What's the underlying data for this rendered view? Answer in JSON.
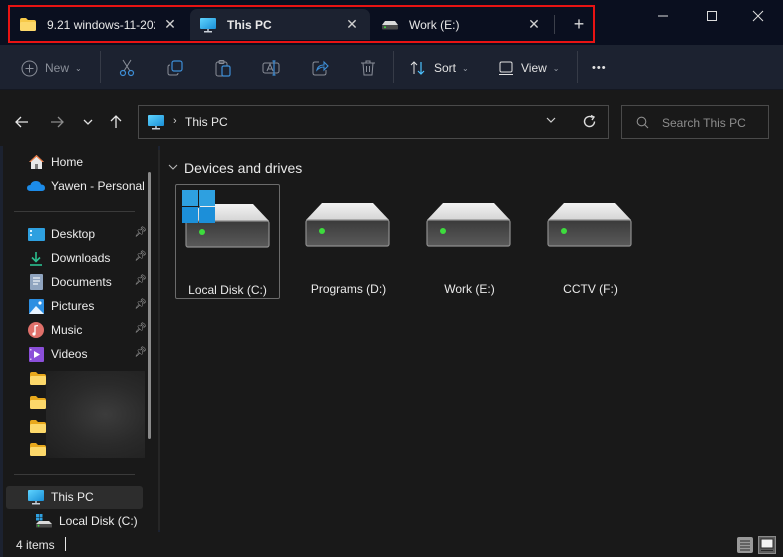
{
  "window": {
    "tabs": [
      {
        "label": "9.21 windows-11-202",
        "icon": "folder-icon",
        "active": false
      },
      {
        "label": "This PC",
        "icon": "this-pc-icon",
        "active": true
      },
      {
        "label": "Work (E:)",
        "icon": "drive-icon",
        "active": false
      }
    ],
    "tab_close_glyph": "✕",
    "new_tab_glyph": "+",
    "controls": {
      "minimize": "minimize-icon",
      "maximize": "maximize-icon",
      "close": "close-icon"
    }
  },
  "toolbar": {
    "new_label": "New",
    "sort_label": "Sort",
    "view_label": "View",
    "more_glyph": "•••",
    "icons": [
      "cut-icon",
      "copy-icon",
      "paste-icon",
      "rename-icon",
      "share-icon",
      "delete-icon"
    ]
  },
  "navigation": {
    "address_segments": [
      "This PC"
    ],
    "search_placeholder": "Search This PC"
  },
  "sidebar": {
    "top_items": [
      {
        "label": "Home",
        "icon": "home-icon"
      },
      {
        "label": "Yawen - Personal",
        "icon": "onedrive-icon"
      }
    ],
    "quick_access": [
      {
        "label": "Desktop",
        "icon": "desktop-icon",
        "pinned": true
      },
      {
        "label": "Downloads",
        "icon": "downloads-icon",
        "pinned": true
      },
      {
        "label": "Documents",
        "icon": "documents-icon",
        "pinned": true
      },
      {
        "label": "Pictures",
        "icon": "pictures-icon",
        "pinned": true
      },
      {
        "label": "Music",
        "icon": "music-icon",
        "pinned": true
      },
      {
        "label": "Videos",
        "icon": "videos-icon",
        "pinned": true
      }
    ],
    "blurred_folders_count": 4,
    "this_pc": {
      "label": "This PC",
      "selected": true
    },
    "this_pc_children": [
      {
        "label": "Local Disk (C:)"
      }
    ]
  },
  "content": {
    "group_title": "Devices and drives",
    "drives": [
      {
        "label": "Local Disk (C:)",
        "system": true,
        "selected": true
      },
      {
        "label": "Programs (D:)",
        "system": false,
        "selected": false
      },
      {
        "label": "Work (E:)",
        "system": false,
        "selected": false
      },
      {
        "label": "CCTV (F:)",
        "system": false,
        "selected": false
      }
    ]
  },
  "status": {
    "item_count": "4 items",
    "view_mode": "tiles"
  },
  "colors": {
    "highlight_frame": "#e81313",
    "accent": "#4cc2ff",
    "drive_led": "#3ddc3d"
  }
}
